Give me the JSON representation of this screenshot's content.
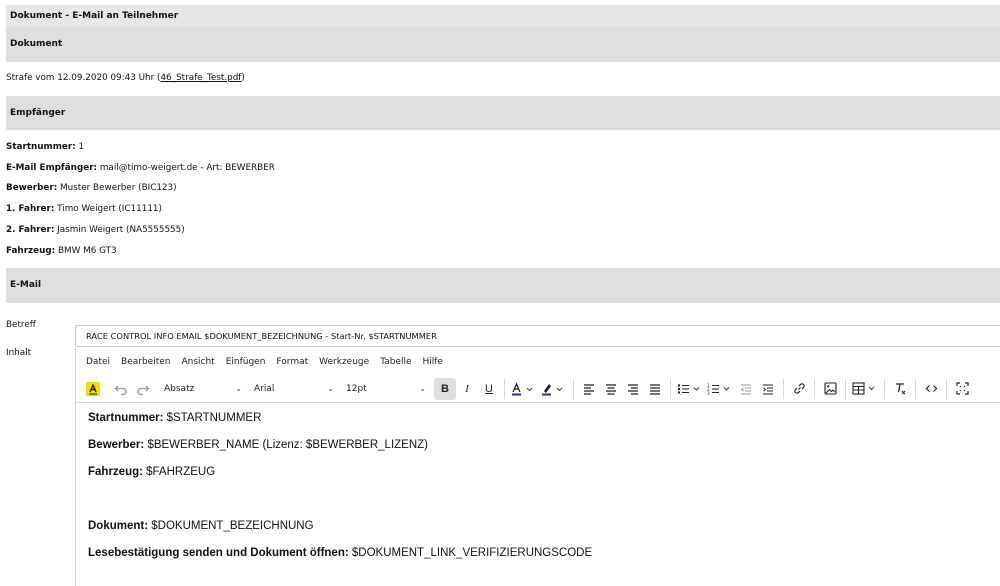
{
  "header": {
    "title": "Dokument - E-Mail an Teilnehmer"
  },
  "sections": {
    "dokument": "Dokument",
    "empfaenger": "Empfänger",
    "email": "E-Mail"
  },
  "dokument": {
    "text": "Strafe vom 12.09.2020 09:43 Uhr (",
    "link": "46_Strafe_Test.pdf",
    "close": ")"
  },
  "recipient": [
    {
      "label": "Startnummer:",
      "value": " 1"
    },
    {
      "label": "E-Mail Empfänger:",
      "value": " mail@timo-weigert.de - Art: BEWERBER"
    },
    {
      "label": "Bewerber:",
      "value": " Muster Bewerber (BIC123)"
    },
    {
      "label": "1. Fahrer:",
      "value": " Timo Weigert (IC11111)"
    },
    {
      "label": "2. Fahrer:",
      "value": " Jasmin Weigert (NA5555555)"
    },
    {
      "label": "Fahrzeug:",
      "value": " BMW M6 GT3"
    }
  ],
  "form": {
    "subject_label": "Betreff",
    "content_label": "Inhalt",
    "subject_value": "RACE CONTROL INFO EMAIL $DOKUMENT_BEZEICHNUNG - Start-Nr. $STARTNUMMER"
  },
  "editor": {
    "menu": [
      "Datei",
      "Bearbeiten",
      "Ansicht",
      "Einfügen",
      "Format",
      "Werkzeuge",
      "Tabelle",
      "Hilfe"
    ],
    "block_format": "Absatz",
    "font_family": "Arial",
    "font_size": "12pt",
    "content": [
      {
        "label": "Startnummer:",
        "value": " $STARTNUMMER"
      },
      {
        "label": "Bewerber:",
        "value": " $BEWERBER_NAME (Lizenz: $BEWERBER_LIZENZ)"
      },
      {
        "label": "Fahrzeug:",
        "value": " $FAHRZEUG"
      },
      {
        "label": "Dokument:",
        "value": " $DOKUMENT_BEZEICHNUNG"
      },
      {
        "label": "Lesebestätigung senden und Dokument öffnen:",
        "value": " $DOKUMENT_LINK_VERIFIZIERUNGSCODE"
      }
    ]
  },
  "colors": {
    "section_bg": "#dedede",
    "highlight_icon": "#f5d90a"
  }
}
